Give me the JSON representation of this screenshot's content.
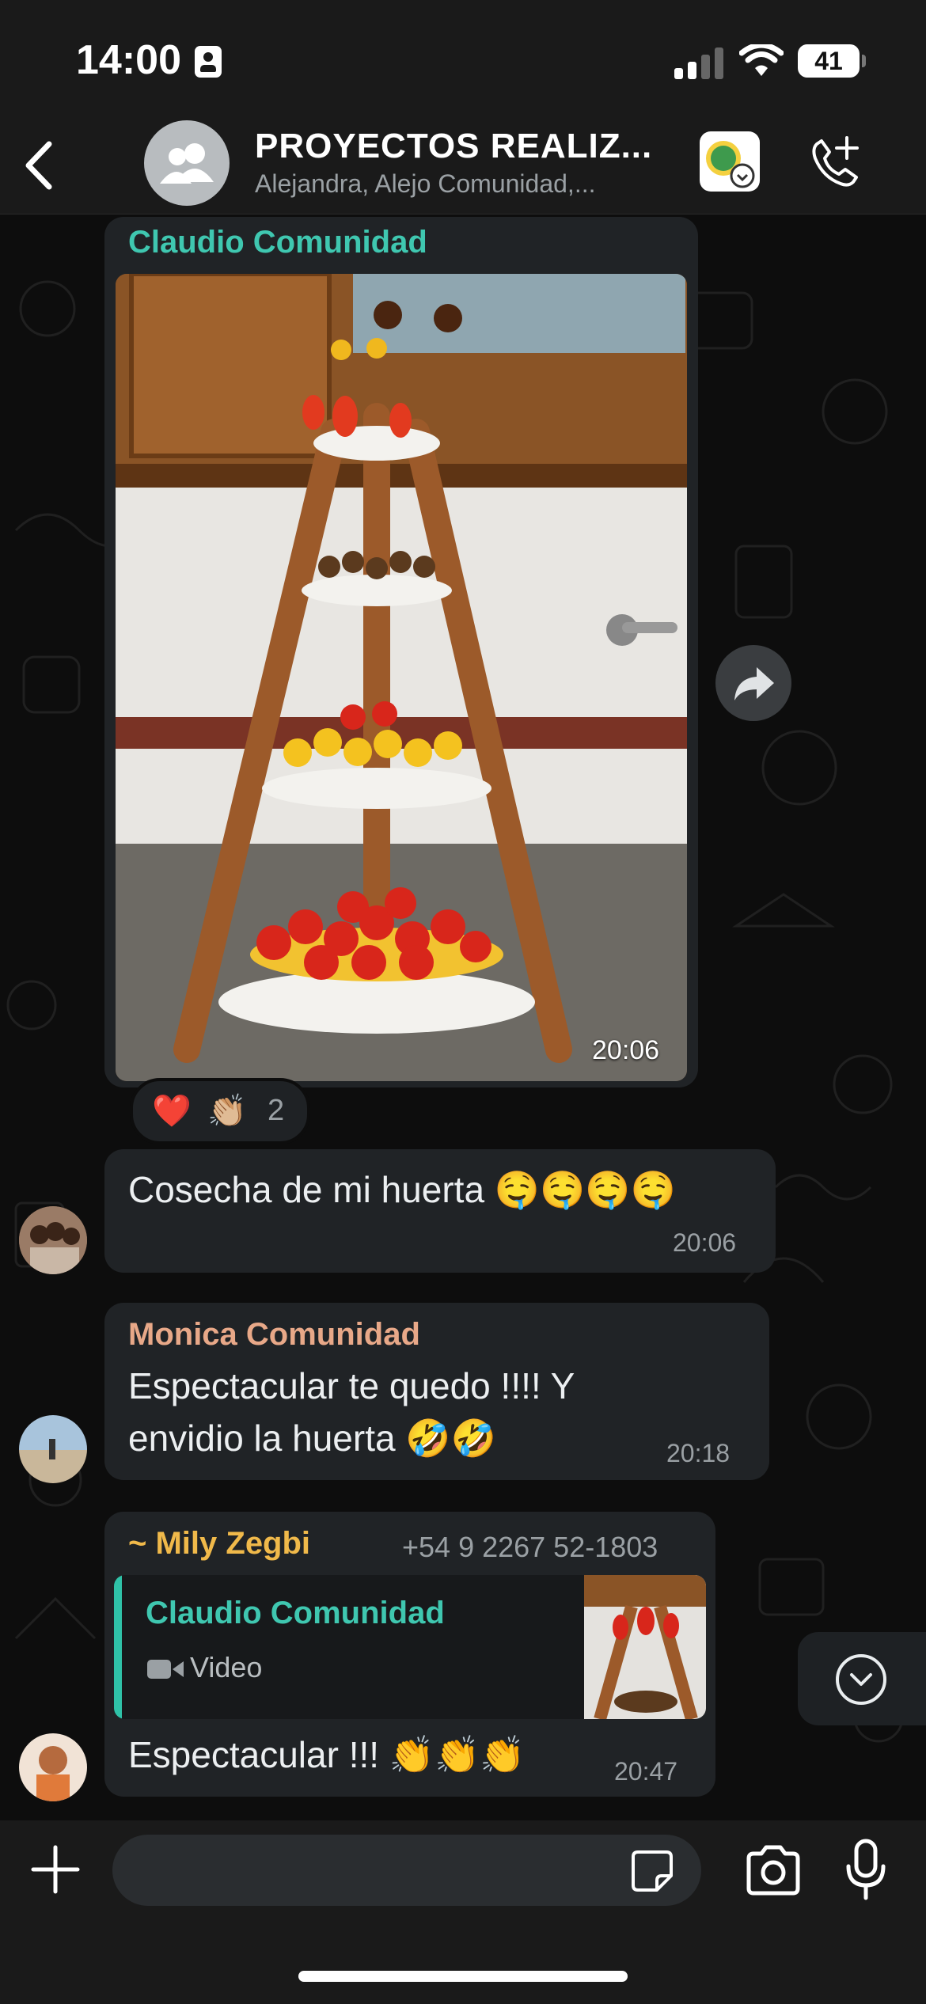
{
  "status_bar": {
    "time": "14:00",
    "battery": "41"
  },
  "header": {
    "title": "PROYECTOS REALIZ...",
    "subtitle": "Alejandra, Alejo Comunidad,..."
  },
  "messages": [
    {
      "sender": "Claudio Comunidad",
      "sender_color": "#3fc7b0",
      "type": "image",
      "time": "20:06",
      "reaction_count": "2"
    },
    {
      "text": "Cosecha de mi huerta 🤤🤤🤤🤤",
      "time": "20:06"
    },
    {
      "sender": "Monica Comunidad",
      "sender_color": "#e8a888",
      "text_line1": "Espectacular te quedo !!!! Y",
      "text_line2": "envidio la huerta 🤣🤣",
      "time": "20:18"
    },
    {
      "sender": "~ Mily Zegbi",
      "sender_color": "#f0b94a",
      "phone": "+54 9 2267 52-1803",
      "quote": {
        "sender": "Claudio Comunidad",
        "kind": "Video"
      },
      "text": "Espectacular !!! 👏👏👏",
      "time": "20:47"
    }
  ],
  "icons": [
    "back-chevron-icon",
    "group-avatar-icon",
    "sticker-icon",
    "add-call-icon",
    "forward-icon",
    "scroll-down-icon",
    "plus-icon",
    "sticker-icon",
    "camera-icon",
    "mic-icon",
    "video-icon"
  ],
  "colors": {
    "bubble": "#202326",
    "background": "#0b0b0b",
    "accent": "#2fc2a8"
  }
}
